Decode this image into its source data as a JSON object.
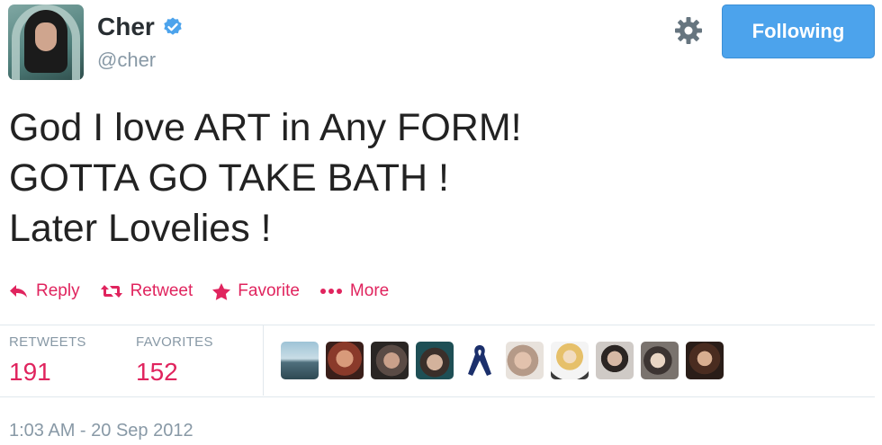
{
  "user": {
    "name": "Cher",
    "handle": "@cher"
  },
  "follow_button": {
    "label": "Following"
  },
  "tweet": {
    "lines": [
      "God I love ART in Any FORM!",
      "GOTTA GO TAKE BATH !",
      "Later Lovelies !"
    ]
  },
  "actions": {
    "reply": "Reply",
    "retweet": "Retweet",
    "favorite": "Favorite",
    "more": "More"
  },
  "stats": {
    "retweets_label": "RETWEETS",
    "retweets_value": "191",
    "favorites_label": "FAVORITES",
    "favorites_value": "152"
  },
  "timestamp": "1:03 AM - 20 Sep 2012",
  "colors": {
    "accent": "#e0245e",
    "follow_button": "#4ca3ec",
    "verified": "#4ca3ec",
    "muted": "#8899a6"
  },
  "icons": {
    "verified": "verified-badge-icon",
    "settings": "gear-icon",
    "reply": "reply-arrow-icon",
    "retweet": "retweet-arrows-icon",
    "favorite": "star-icon",
    "more": "dots-icon"
  }
}
